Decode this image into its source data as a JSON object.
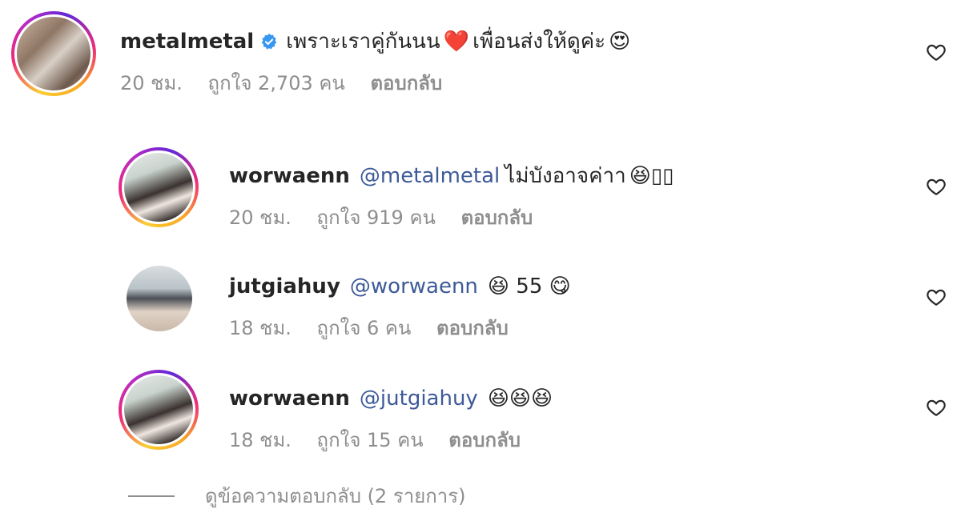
{
  "comments": [
    {
      "username": "metalmetal",
      "verified": true,
      "mention": "",
      "text": "เพราะเราคู่กันนน",
      "emoji_mid": "❤️",
      "text2": "เพื่อนส่งให้ดูค่ะ",
      "emoji_end": "😍",
      "time": "20 ชม.",
      "likes": "ถูกใจ 2,703 คน",
      "reply": "ตอบกลับ",
      "icon": "heart-outline-icon"
    },
    {
      "username": "worwaenn",
      "mention": "@metalmetal",
      "text": "ไม่บังอาจค่าา",
      "emoji_end": "😆▯▯",
      "time": "20 ชม.",
      "likes": "ถูกใจ 919 คน",
      "reply": "ตอบกลับ",
      "icon": "heart-outline-icon"
    },
    {
      "username": "jutgiahuy",
      "mention": "@worwaenn",
      "text": "😆 55 😋",
      "time": "18 ชม.",
      "likes": "ถูกใจ 6 คน",
      "reply": "ตอบกลับ",
      "icon": "heart-outline-icon"
    },
    {
      "username": "worwaenn",
      "mention": "@jutgiahuy",
      "text": "😆😆😆",
      "time": "18 ชม.",
      "likes": "ถูกใจ 15 คน",
      "reply": "ตอบกลับ",
      "icon": "heart-outline-icon"
    }
  ],
  "view_replies": "ดูข้อความตอบกลับ (2 รายการ)",
  "colors": {
    "mention": "#3d5a98",
    "meta": "#8e8e8e",
    "text": "#262626",
    "verified": "#3897f0"
  }
}
